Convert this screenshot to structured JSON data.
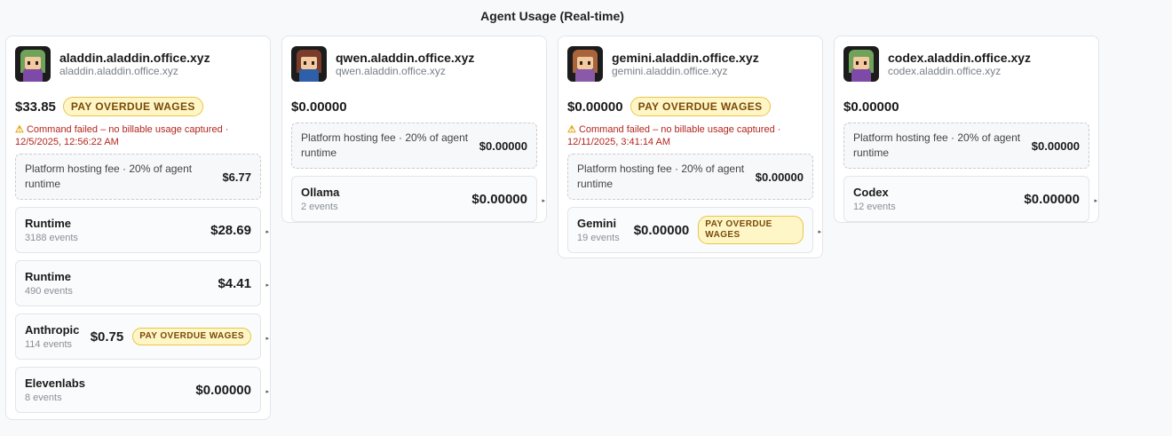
{
  "page_title": "Agent Usage (Real-time)",
  "colors": {
    "badge_bg": "#fff6c8",
    "badge_border": "#e9c546",
    "badge_text": "#7a4a06",
    "warning_text": "#b3261e"
  },
  "cards": [
    {
      "host": "aladdin.aladdin.office.xyz",
      "host_sub": "aladdin.aladdin.office.xyz",
      "total": "$33.85",
      "badge": "PAY OVERDUE WAGES",
      "warning": "Command failed – no billable usage captured · 12/5/2025, 12:56:22 AM",
      "fee_label": "Platform hosting fee · 20% of agent runtime",
      "fee_amount": "$6.77",
      "items": [
        {
          "name": "Runtime",
          "events": "3188 events",
          "amount": "$28.69"
        },
        {
          "name": "Runtime",
          "events": "490 events",
          "amount": "$4.41"
        },
        {
          "name": "Anthropic",
          "events": "114 events",
          "amount": "$0.75",
          "badge": "PAY OVERDUE WAGES"
        },
        {
          "name": "Elevenlabs",
          "events": "8 events",
          "amount": "$0.00000"
        }
      ]
    },
    {
      "host": "qwen.aladdin.office.xyz",
      "host_sub": "qwen.aladdin.office.xyz",
      "total": "$0.00000",
      "fee_label": "Platform hosting fee · 20% of agent runtime",
      "fee_amount": "$0.00000",
      "items": [
        {
          "name": "Ollama",
          "events": "2 events",
          "amount": "$0.00000"
        }
      ]
    },
    {
      "host": "gemini.aladdin.office.xyz",
      "host_sub": "gemini.aladdin.office.xyz",
      "total": "$0.00000",
      "badge": "PAY OVERDUE WAGES",
      "warning": "Command failed – no billable usage captured · 12/11/2025, 3:41:14 AM",
      "fee_label": "Platform hosting fee · 20% of agent runtime",
      "fee_amount": "$0.00000",
      "items": [
        {
          "name": "Gemini",
          "events": "19 events",
          "amount": "$0.00000",
          "badge": "PAY OVERDUE WAGES"
        }
      ]
    },
    {
      "host": "codex.aladdin.office.xyz",
      "host_sub": "codex.aladdin.office.xyz",
      "total": "$0.00000",
      "fee_label": "Platform hosting fee · 20% of agent runtime",
      "fee_amount": "$0.00000",
      "items": [
        {
          "name": "Codex",
          "events": "12 events",
          "amount": "$0.00000"
        }
      ]
    }
  ],
  "icons": {
    "warning": "warning-icon",
    "expand": "expand-arrow-icon",
    "avatar": "pixel-avatar"
  }
}
